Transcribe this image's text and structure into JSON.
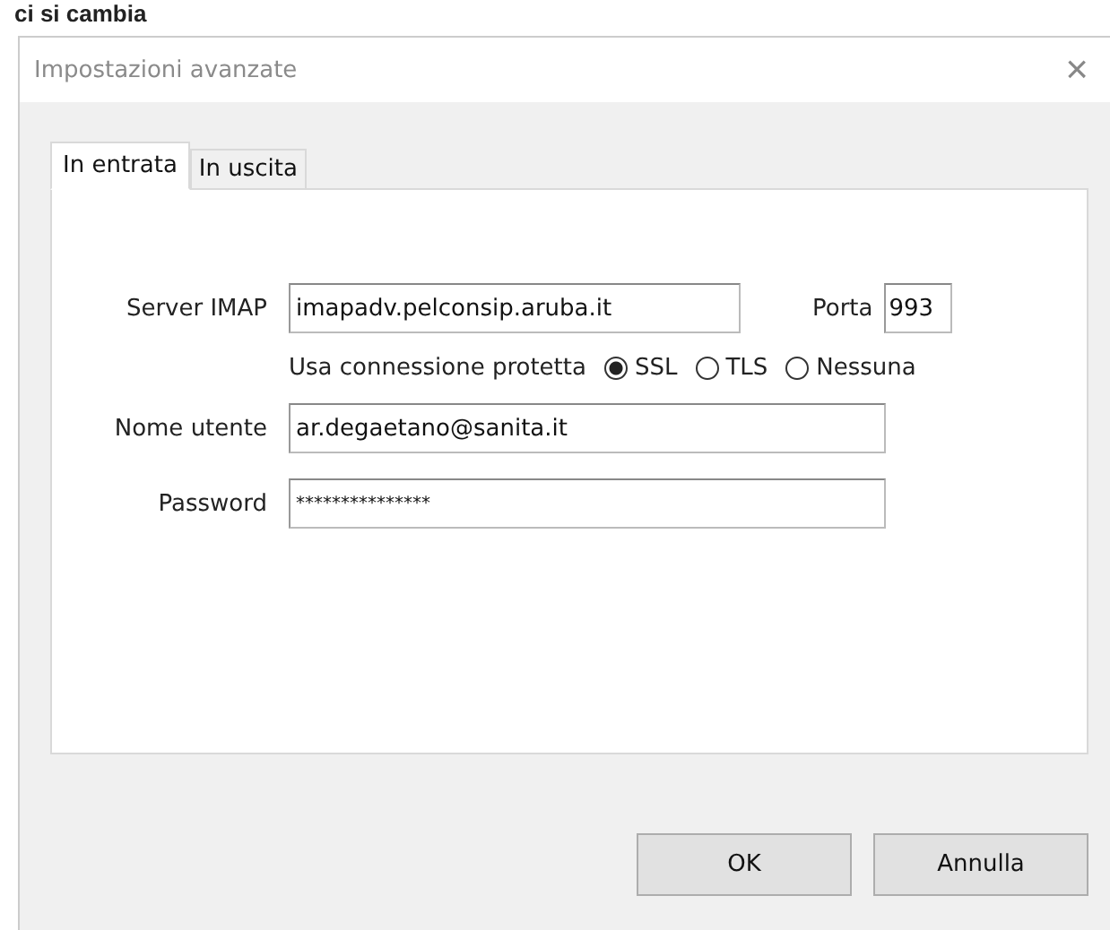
{
  "background_text": "ci si cambia",
  "window": {
    "title": "Impostazioni avanzate",
    "close": "×"
  },
  "tabs": [
    {
      "label": "In entrata",
      "selected": true
    },
    {
      "label": "In uscita",
      "selected": false
    }
  ],
  "form": {
    "server": {
      "label": "Server IMAP",
      "value": "imapadv.pelconsip.aruba.it"
    },
    "port": {
      "label": "Porta",
      "value": "993"
    },
    "security": {
      "label": "Usa connessione protetta",
      "options": [
        {
          "label": "SSL",
          "selected": true
        },
        {
          "label": "TLS",
          "selected": false
        },
        {
          "label": "Nessuna",
          "selected": false
        }
      ]
    },
    "username": {
      "label": "Nome utente",
      "value": "ar.degaetano@sanita.it"
    },
    "password": {
      "label": "Password",
      "value": "***************"
    }
  },
  "buttons": [
    "OK",
    "Annulla"
  ]
}
